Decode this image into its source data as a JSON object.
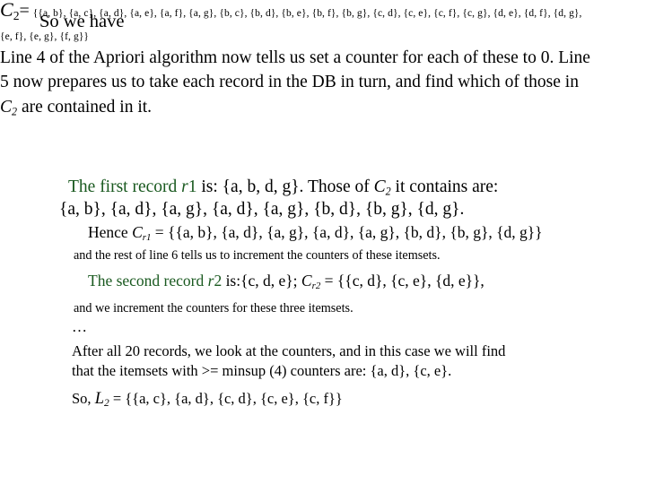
{
  "slide": {
    "heading": "So we have",
    "background_color": "#ffffff",
    "text_color": "#000000",
    "highlight_color": "#19591f"
  },
  "c2_definition": {
    "symbol": "C",
    "subscript": "2",
    "equals": "=",
    "itemsets_text": "{{a, b}, {a, c}, {a, d}, {a, e}, {a, f}, {a, g}, {b, c}, {b, d}, {b, e}, {b, f}, {b, g}, {c, d}, {c, e}, {c, f}, {c, g}, {d, e}, {d, f}, {d, g}, {e, f}, {e, g}, {f, g}}",
    "itemsets": [
      "{a, b}",
      "{a, c}",
      "{a, d}",
      "{a, e}",
      "{a, f}",
      "{a, g}",
      "{b, c}",
      "{b, d}",
      "{b, e}",
      "{b, f}",
      "{b, g}",
      "{c, d}",
      "{c, e}",
      "{c, f}",
      "{c, g}",
      "{d, e}",
      "{d, f}",
      "{d, g}",
      "{e, f}",
      "{e, g}",
      "{f, g}"
    ]
  },
  "body": {
    "part1": "Line 4 of the Apriori algorithm now tells us set a counter for each of these to 0. Line 5 now prepares us to take each record in the DB in turn, and find which of those in ",
    "math_c": "C",
    "math_c_sub": "2",
    "part2": " are contained in it."
  },
  "first_record": {
    "green_prefix": "The first record ",
    "green_var": "r",
    "green_var_num": "1",
    "rest": " is: {a, b, d, g}. Those of ",
    "math_c": "C",
    "math_c_sub": "2",
    "rest2": " it contains are:",
    "contained_line": "{a, b}, {a, d}, {a, g}, {a, d}, {a, g}, {b, d}, {b, g}, {d, g}."
  },
  "hence": {
    "prefix": "Hence ",
    "math_c": "C",
    "math_c_sub": "r1",
    "equals": " = ",
    "value": "{{a, b}, {a, d}, {a, g}, {a, d}, {a, g}, {b, d}, {b, g}, {d, g}}",
    "note": "and the rest of line 6 tells us to increment the counters of these itemsets."
  },
  "second_record": {
    "green_prefix": "The second record ",
    "green_var": "r",
    "green_var_num": "2",
    "rest": " is:{c, d, e};  ",
    "math_c": "C",
    "math_c_sub": "r2",
    "equals": " = ",
    "value": "{{c, d}, {c, e}, {d, e}},",
    "note": "and we increment the counters for these three itemsets."
  },
  "ellipsis": "…",
  "conclusion": {
    "line1": "After all 20 records, we look at the counters, and in this case we will find",
    "line2": "that the itemsets with >= minsup (4) counters are: {a, d}, {c, e}.",
    "line3_prefix": "So, ",
    "math_l": "L",
    "math_l_sub": "2",
    "line3_equals": " = ",
    "line3_value": "{{a, c}, {a, d}, {c, d},  {c, e}, {c, f}}"
  }
}
